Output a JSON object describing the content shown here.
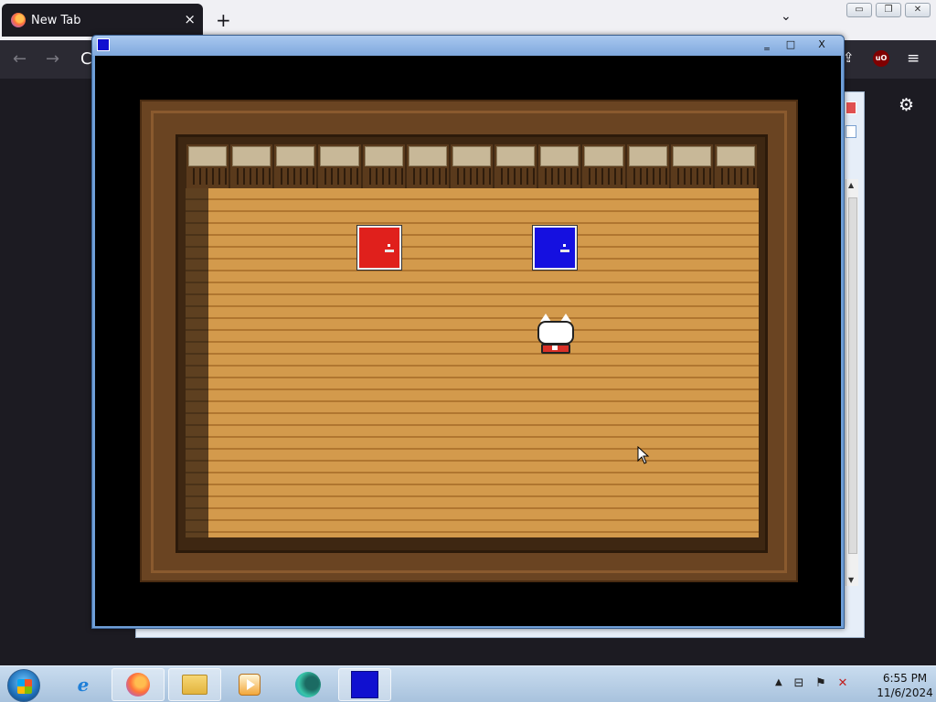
{
  "browser": {
    "tab_title": "New Tab",
    "tab_close": "×",
    "new_tab": "+",
    "list_tabs": "⌄",
    "back": "←",
    "forward": "→",
    "reload": "C",
    "menu": "≡",
    "share": "⇪",
    "settings": "⚙",
    "ublock": "uO",
    "win_minimize": "▭",
    "win_restore": "❐",
    "win_close": "✕"
  },
  "game_window": {
    "minimize": "‗",
    "maximize": "□",
    "close": "X",
    "icon_color": "#1010d0"
  },
  "scene": {
    "door_red_color": "#e0201c",
    "door_blue_color": "#1510e0",
    "floor_color": "#d39a4c",
    "wall_color": "#3e2712",
    "panel_count": 13
  },
  "taskbar": {
    "ie_glyph": "e",
    "tray_show_hidden": "▲",
    "tray_network": "⊟",
    "tray_flag": "⚑",
    "tray_volume": "✕",
    "clock_time": "6:55 PM",
    "clock_date": "11/6/2024"
  }
}
